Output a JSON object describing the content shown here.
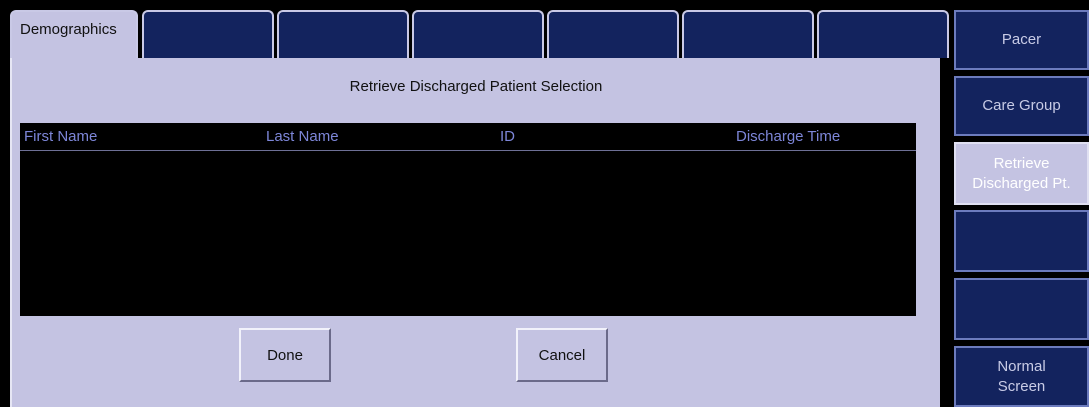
{
  "tabs": [
    "Demographics",
    "",
    "",
    "",
    "",
    "",
    ""
  ],
  "panel": {
    "title": "Retrieve Discharged Patient Selection"
  },
  "table": {
    "columns": [
      "First Name",
      "Last Name",
      "ID",
      "Discharge Time"
    ],
    "rows": []
  },
  "buttons": {
    "done": "Done",
    "cancel": "Cancel"
  },
  "side": {
    "pacer": "Pacer",
    "care_group": "Care Group",
    "retrieve": "Retrieve\nDischarged Pt.",
    "blank1": "",
    "blank2": "",
    "normal_screen": "Normal\nScreen"
  },
  "colors": {
    "panel_bg": "#c4c3e2",
    "tab_inactive": "#13235e",
    "table_bg": "#000000",
    "header_text": "#7d86d8"
  }
}
